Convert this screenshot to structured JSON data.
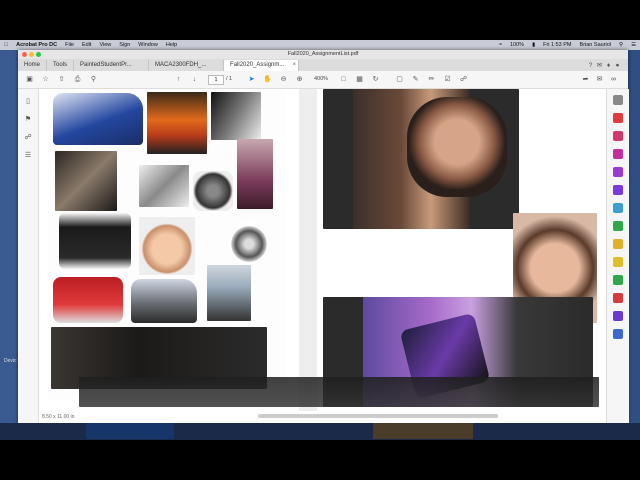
{
  "menubar": {
    "app_name": "Acrobat Pro DC",
    "items": [
      "File",
      "Edit",
      "View",
      "Sign",
      "Window",
      "Help"
    ],
    "battery": "100%",
    "clock": "Fri 1:53 PM",
    "user": "Brian Sauriol"
  },
  "window": {
    "title": "Fall2020_AssignmentList.pdf",
    "tabs": {
      "home": "Home",
      "tools": "Tools",
      "doc1": "PaintedStudentPr...",
      "doc2": "MACA2300FDH_...",
      "doc3": "Fall2020_Assignm..."
    },
    "toolbar": {
      "page_current": "1",
      "page_total": "/ 1",
      "zoom": "400%"
    },
    "page_size": "8.50 x 11.00 in"
  },
  "desktop": {
    "icon_label": "Devic"
  },
  "colors": {
    "accent": "#1473e6",
    "desktop": "#2f4f83"
  }
}
